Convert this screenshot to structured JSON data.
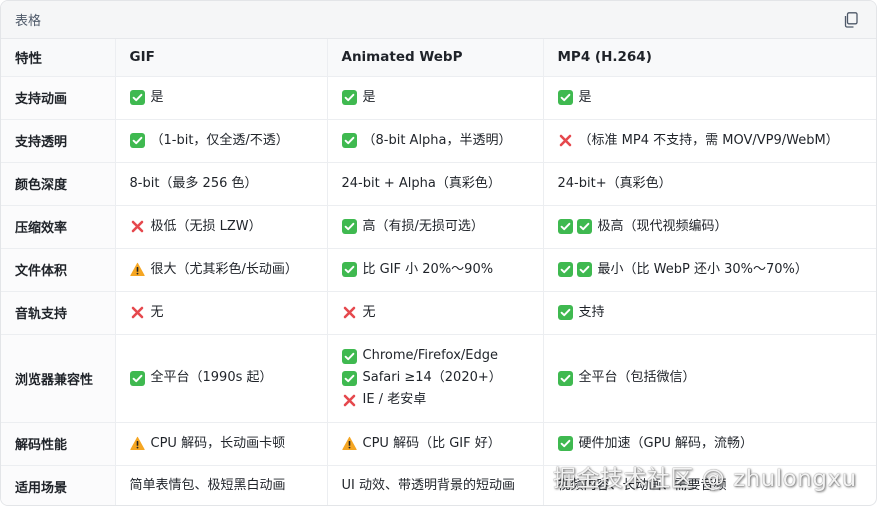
{
  "header": {
    "title": "表格"
  },
  "table": {
    "columns": [
      "特性",
      "GIF",
      "Animated WebP",
      "MP4 (H.264)"
    ],
    "rows": [
      {
        "feature": "支持动画",
        "cells": [
          [
            {
              "icons": [
                "check"
              ],
              "text": "是"
            }
          ],
          [
            {
              "icons": [
                "check"
              ],
              "text": "是"
            }
          ],
          [
            {
              "icons": [
                "check"
              ],
              "text": "是"
            }
          ]
        ]
      },
      {
        "feature": "支持透明",
        "cells": [
          [
            {
              "icons": [
                "check"
              ],
              "text": "（1-bit，仅全透/不透）"
            }
          ],
          [
            {
              "icons": [
                "check"
              ],
              "text": "（8-bit Alpha，半透明）"
            }
          ],
          [
            {
              "icons": [
                "cross"
              ],
              "text": "（标准 MP4 不支持，需 MOV/VP9/WebM）"
            }
          ]
        ]
      },
      {
        "feature": "颜色深度",
        "cells": [
          [
            {
              "icons": [],
              "text": "8-bit（最多 256 色）"
            }
          ],
          [
            {
              "icons": [],
              "text": "24-bit + Alpha（真彩色）"
            }
          ],
          [
            {
              "icons": [],
              "text": "24-bit+（真彩色）"
            }
          ]
        ]
      },
      {
        "feature": "压缩效率",
        "cells": [
          [
            {
              "icons": [
                "cross"
              ],
              "text": "极低（无损 LZW）"
            }
          ],
          [
            {
              "icons": [
                "check"
              ],
              "text": "高（有损/无损可选）"
            }
          ],
          [
            {
              "icons": [
                "check",
                "check"
              ],
              "text": "极高（现代视频编码）"
            }
          ]
        ]
      },
      {
        "feature": "文件体积",
        "cells": [
          [
            {
              "icons": [
                "warning"
              ],
              "text": "很大（尤其彩色/长动画）"
            }
          ],
          [
            {
              "icons": [
                "check"
              ],
              "text": "比 GIF 小 20%～90%"
            }
          ],
          [
            {
              "icons": [
                "check",
                "check"
              ],
              "text": "最小（比 WebP 还小 30%～70%）"
            }
          ]
        ]
      },
      {
        "feature": "音轨支持",
        "cells": [
          [
            {
              "icons": [
                "cross"
              ],
              "text": "无"
            }
          ],
          [
            {
              "icons": [
                "cross"
              ],
              "text": "无"
            }
          ],
          [
            {
              "icons": [
                "check"
              ],
              "text": "支持"
            }
          ]
        ]
      },
      {
        "feature": "浏览器兼容性",
        "tall": true,
        "cells": [
          [
            {
              "icons": [
                "check"
              ],
              "text": "全平台（1990s 起）"
            }
          ],
          [
            {
              "icons": [
                "check"
              ],
              "text": "Chrome/Firefox/Edge"
            },
            {
              "icons": [
                "check"
              ],
              "text": "Safari ≥14（2020+）"
            },
            {
              "icons": [
                "cross"
              ],
              "text": "IE / 老安卓"
            }
          ],
          [
            {
              "icons": [
                "check"
              ],
              "text": "全平台（包括微信）"
            }
          ]
        ]
      },
      {
        "feature": "解码性能",
        "cells": [
          [
            {
              "icons": [
                "warning"
              ],
              "text": "CPU 解码，长动画卡顿"
            }
          ],
          [
            {
              "icons": [
                "warning"
              ],
              "text": "CPU 解码（比 GIF 好）"
            }
          ],
          [
            {
              "icons": [
                "check"
              ],
              "text": "硬件加速（GPU 解码，流畅）"
            }
          ]
        ]
      },
      {
        "feature": "适用场景",
        "cells": [
          [
            {
              "icons": [],
              "text": "简单表情包、极短黑白动画"
            }
          ],
          [
            {
              "icons": [],
              "text": "UI 动效、带透明背景的短动画"
            }
          ],
          [
            {
              "icons": [],
              "text": "视频内容、长动画、需要音频"
            }
          ]
        ]
      }
    ]
  },
  "watermark": "掘金技术社区 @ zhulongxu",
  "colors": {
    "check": "#3fb950",
    "cross": "#e5484d",
    "warning": "#f5a623"
  }
}
